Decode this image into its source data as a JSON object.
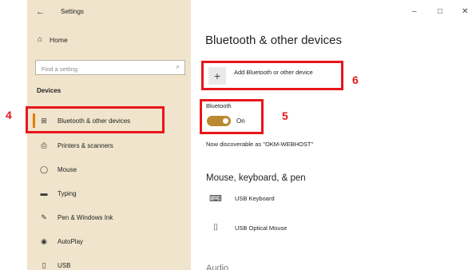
{
  "window": {
    "app_title": "Settings",
    "back_glyph": "←",
    "controls": {
      "minimize": "–",
      "maximize": "□",
      "close": "✕"
    }
  },
  "sidebar": {
    "home": {
      "label": "Home",
      "icon": "home-icon",
      "glyph": "⌂"
    },
    "search": {
      "placeholder": "Find a setting",
      "icon": "search-icon",
      "glyph": "⌕"
    },
    "section_heading": "Devices",
    "items": [
      {
        "label": "Bluetooth & other devices",
        "icon": "bluetooth-devices-icon",
        "glyph": "⊞",
        "selected": true
      },
      {
        "label": "Printers & scanners",
        "icon": "printer-icon",
        "glyph": "⎙",
        "selected": false
      },
      {
        "label": "Mouse",
        "icon": "mouse-icon",
        "glyph": "◯",
        "selected": false
      },
      {
        "label": "Typing",
        "icon": "keyboard-icon",
        "glyph": "▬",
        "selected": false
      },
      {
        "label": "Pen & Windows Ink",
        "icon": "pen-icon",
        "glyph": "✎",
        "selected": false
      },
      {
        "label": "AutoPlay",
        "icon": "autoplay-icon",
        "glyph": "◉",
        "selected": false
      },
      {
        "label": "USB",
        "icon": "usb-icon",
        "glyph": "▯",
        "selected": false
      }
    ]
  },
  "main": {
    "title": "Bluetooth & other devices",
    "add_device": {
      "label": "Add Bluetooth or other device",
      "glyph": "+"
    },
    "bluetooth": {
      "label": "Bluetooth",
      "state": "On",
      "enabled": true,
      "discoverable_text": "Now discoverable as \"OKM-WEBHOST\""
    },
    "mouse_keyboard_pen": {
      "heading": "Mouse, keyboard, & pen",
      "devices": [
        {
          "name": "USB Keyboard",
          "icon": "keyboard-icon",
          "glyph": "⌨"
        },
        {
          "name": "USB Optical Mouse",
          "icon": "mouse-icon",
          "glyph": "⌷"
        }
      ]
    },
    "next_heading_partial": "Audio"
  },
  "annotations": [
    {
      "number": "4",
      "target": "Bluetooth & other devices"
    },
    {
      "number": "5",
      "target": "Bluetooth toggle"
    },
    {
      "number": "6",
      "target": "Add Bluetooth or other device"
    }
  ],
  "colors": {
    "sidebar_bg": "#f0e4cc",
    "accent": "#e07b00",
    "toggle_on": "#b98a2f",
    "callout_red": "#e8161c"
  }
}
